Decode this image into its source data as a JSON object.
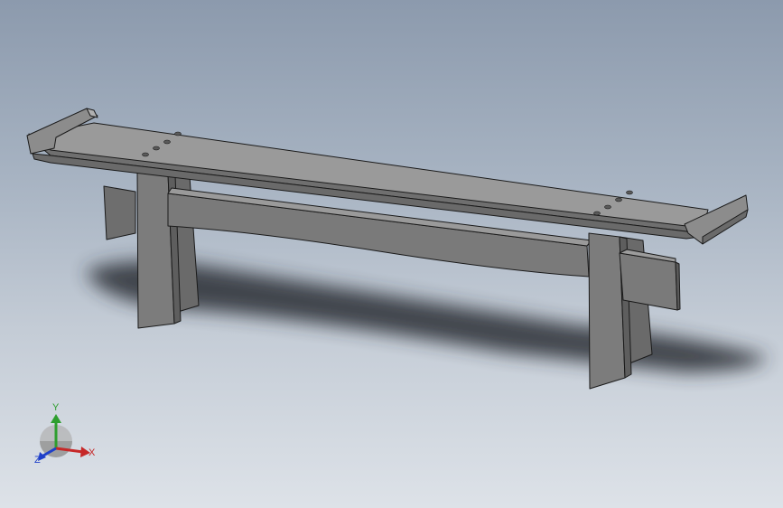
{
  "viewport": {
    "background_top": "#8c9aad",
    "background_bottom": "#dde2e8"
  },
  "model": {
    "name": "bench",
    "face_color": "#8a8a8a",
    "edge_color": "#1a1a1a",
    "shadow_color": "#2a2f36"
  },
  "triad": {
    "x_label": "X",
    "y_label": "Y",
    "z_label": "Z",
    "x_color": "#c62828",
    "y_color": "#2e9e2e",
    "z_color": "#1e3fc9"
  }
}
